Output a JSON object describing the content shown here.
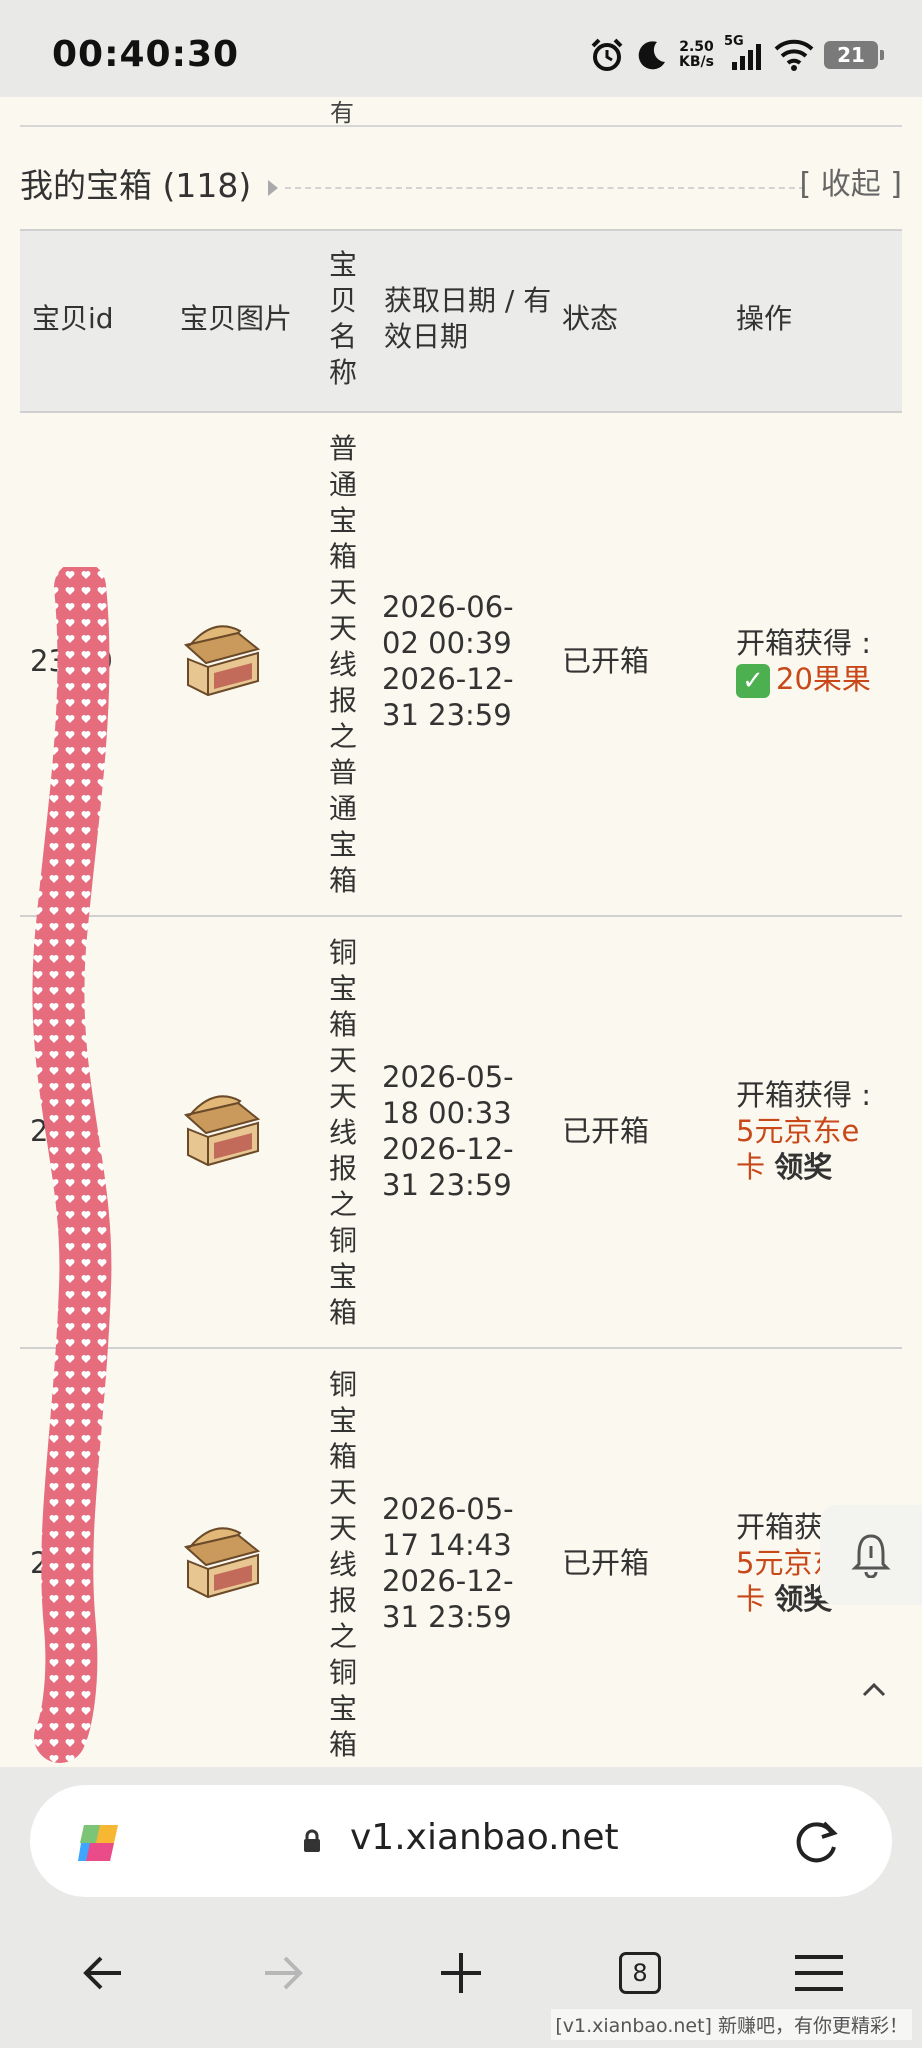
{
  "status_bar": {
    "time": "00:40:30",
    "net_speed_value": "2.50",
    "net_speed_unit": "KB/s",
    "network": "5G",
    "battery": "21",
    "icons": [
      "alarm-icon",
      "moon-icon",
      "signal-icon",
      "wifi-icon",
      "battery-icon"
    ]
  },
  "section": {
    "title": "我的宝箱 (118)",
    "collapse_label": "[ 收起 ]",
    "cut_text": "有"
  },
  "table": {
    "headers": {
      "id": "宝贝id",
      "image": "宝贝图片",
      "name": "宝贝名称",
      "date": "获取日期 / 有效日期",
      "status": "状态",
      "action": "操作"
    },
    "rows": [
      {
        "id": "23···9",
        "name": "普通宝箱天天线报之普通宝箱",
        "date": "2026-06-02 00:39 2026-12-31 23:59",
        "status": "已开箱",
        "action_prefix": "开箱获得 :",
        "check": "✓",
        "reward": "20果果",
        "claim": ""
      },
      {
        "id": "2···7",
        "name": "铜宝箱天天线报之铜宝箱",
        "date": "2026-05-18 00:33 2026-12-31 23:59",
        "status": "已开箱",
        "action_prefix": "开箱获得 :",
        "check": "",
        "reward": "5元京东e卡",
        "claim": "领奖"
      },
      {
        "id": "2···9",
        "name": "铜宝箱天天线报之铜宝箱",
        "date": "2026-05-17 14:43 2026-12-31 23:59",
        "status": "已开箱",
        "action_prefix": "开箱获得 :",
        "check": "",
        "reward": "5元京东e卡",
        "claim": "领奖"
      }
    ]
  },
  "browser": {
    "url": "v1.xianbao.net",
    "tab_count": "8"
  },
  "watermark": "[v1.xianbao.net] 新赚吧，有你更精彩！"
}
